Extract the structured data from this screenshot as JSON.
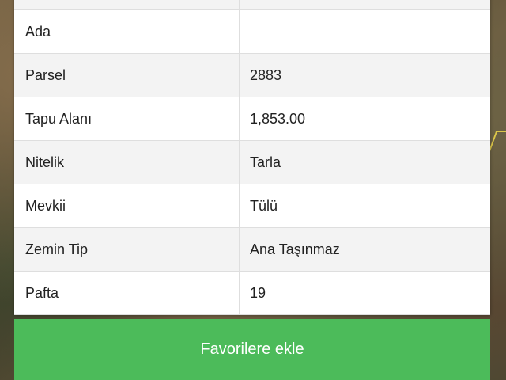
{
  "table": {
    "rows": [
      {
        "label": "",
        "value": ""
      },
      {
        "label": "Ada",
        "value": ""
      },
      {
        "label": "Parsel",
        "value": "2883"
      },
      {
        "label": "Tapu Alanı",
        "value": "1,853.00"
      },
      {
        "label": "Nitelik",
        "value": "Tarla"
      },
      {
        "label": "Mevkii",
        "value": "Tülü"
      },
      {
        "label": "Zemin Tip",
        "value": "Ana Taşınmaz"
      },
      {
        "label": "Pafta",
        "value": "19"
      }
    ]
  },
  "actions": {
    "favorite_label": "Favorilere ekle"
  },
  "colors": {
    "button_green": "#4cbb5a",
    "row_alt": "#f3f3f3"
  }
}
